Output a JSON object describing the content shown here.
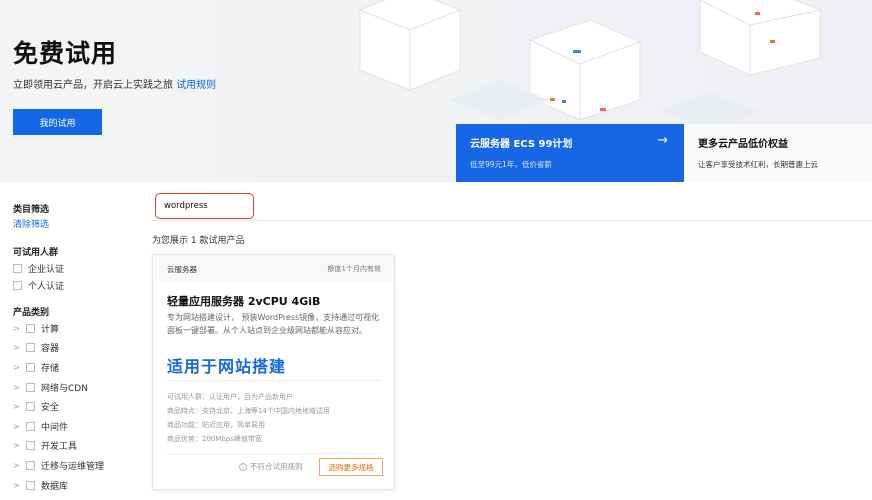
{
  "hero": {
    "title": "免费试用",
    "subtitle": "立即领用云产品，开启云上实践之旅",
    "rules_link": "试用规则",
    "my_trial_button": "我的试用"
  },
  "promos": [
    {
      "title": "云服务器 ECS 99计划",
      "subtitle": "低至99元1年，低价省薪",
      "arrow": "→"
    },
    {
      "title": "更多云产品低价权益",
      "subtitle": "让客户享受技术红利，长期普惠上云"
    }
  ],
  "sidebar": {
    "category_filter": "类目筛选",
    "clear_filter": "清除筛选",
    "audience_heading": "可试用人群",
    "audience": [
      "企业认证",
      "个人认证"
    ],
    "product_category_heading": "产品类别",
    "categories": [
      "计算",
      "容器",
      "存储",
      "网络与CDN",
      "安全",
      "中间件",
      "开发工具",
      "迁移与运维管理",
      "数据库"
    ]
  },
  "search": {
    "value": "wordpress"
  },
  "results": {
    "count_text": "为您展示 1 款试用产品"
  },
  "card": {
    "category": "云服务器",
    "validity": "额度1个月内有效",
    "title": "轻量应用服务器 2vCPU 4GiB",
    "description": "专为网站搭建设计， 预装WordPress镜像，支持通过可视化面板一键部署。从个人站点到企业级网站都能从容应对。",
    "highlight": "适用于网站搭建",
    "specs": [
      "可试用人群：认证用户，且为产品新用户",
      "商品特点：支持北京、上海等14个中国内地地域试用",
      "商品功能：贴近应用，简单易用",
      "商品优势：200Mbps峰值带宽"
    ],
    "ineligible": "不符合试用规则",
    "more_specs_button": "选购更多规格"
  },
  "colors": {
    "accent": "#1467e6",
    "link": "#0c6ee3",
    "highlight_red": "#d63a3a",
    "orange": "#e56a00"
  }
}
